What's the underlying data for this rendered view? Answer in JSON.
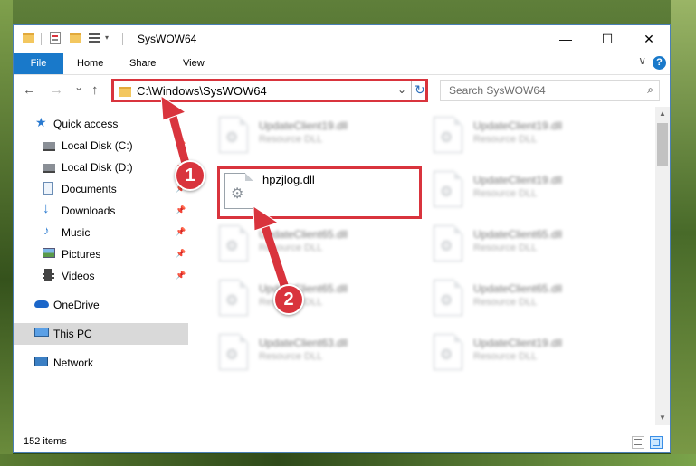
{
  "window": {
    "title": "SysWOW64",
    "controls": {
      "minimize": "—",
      "maximize": "☐",
      "close": "✕"
    }
  },
  "ribbon": {
    "tabs": [
      {
        "label": "File"
      },
      {
        "label": "Home"
      },
      {
        "label": "Share"
      },
      {
        "label": "View"
      }
    ],
    "collapse_glyph": "∨",
    "help_glyph": "?"
  },
  "nav": {
    "back": "←",
    "forward": "→",
    "recent": "⌄",
    "up": "↑"
  },
  "address": {
    "path": "C:\\Windows\\SysWOW64",
    "dropdown": "⌄",
    "refresh": "↻"
  },
  "search": {
    "placeholder": "Search SysWOW64",
    "icon": "⌕"
  },
  "sidebar": {
    "items": [
      {
        "label": "Quick access",
        "icon": "star-icon"
      },
      {
        "label": "Local Disk (C:)",
        "icon": "drive-icon"
      },
      {
        "label": "Local Disk (D:)",
        "icon": "drive-icon"
      },
      {
        "label": "Documents",
        "icon": "documents-icon"
      },
      {
        "label": "Downloads",
        "icon": "downloads-icon"
      },
      {
        "label": "Music",
        "icon": "music-icon"
      },
      {
        "label": "Pictures",
        "icon": "pictures-icon"
      },
      {
        "label": "Videos",
        "icon": "videos-icon"
      },
      {
        "label": "OneDrive",
        "icon": "cloud-icon"
      },
      {
        "label": "This PC",
        "icon": "computer-icon"
      },
      {
        "label": "Network",
        "icon": "network-icon"
      }
    ],
    "pin_glyph": "📌"
  },
  "files": {
    "selected": {
      "name": "hpzjlog.dll"
    },
    "background": [
      {
        "name": "UpdateClient19.dll",
        "type": "Resource DLL"
      },
      {
        "name": "UpdateClient65.dll",
        "type": "Resource DLL"
      },
      {
        "name": "UpdateClient65.dll",
        "type": "Resource DLL"
      },
      {
        "name": "UpdateClient63.dll",
        "type": "Resource DLL"
      },
      {
        "name": "UpdateClient19.dll",
        "type": "Resource DLL"
      },
      {
        "name": "UpdateClient19.dll",
        "type": "Resource DLL"
      },
      {
        "name": "UpdateClient65.dll",
        "type": "Resource DLL"
      },
      {
        "name": "UpdateClient65.dll",
        "type": "Resource DLL"
      },
      {
        "name": "UpdateClient19.dll",
        "type": "Resource DLL"
      }
    ]
  },
  "status": {
    "item_count": "152 items"
  },
  "callouts": {
    "one": "1",
    "two": "2"
  },
  "colors": {
    "accent": "#1979ca",
    "highlight": "#d9343d",
    "selection": "#cce8ff"
  }
}
